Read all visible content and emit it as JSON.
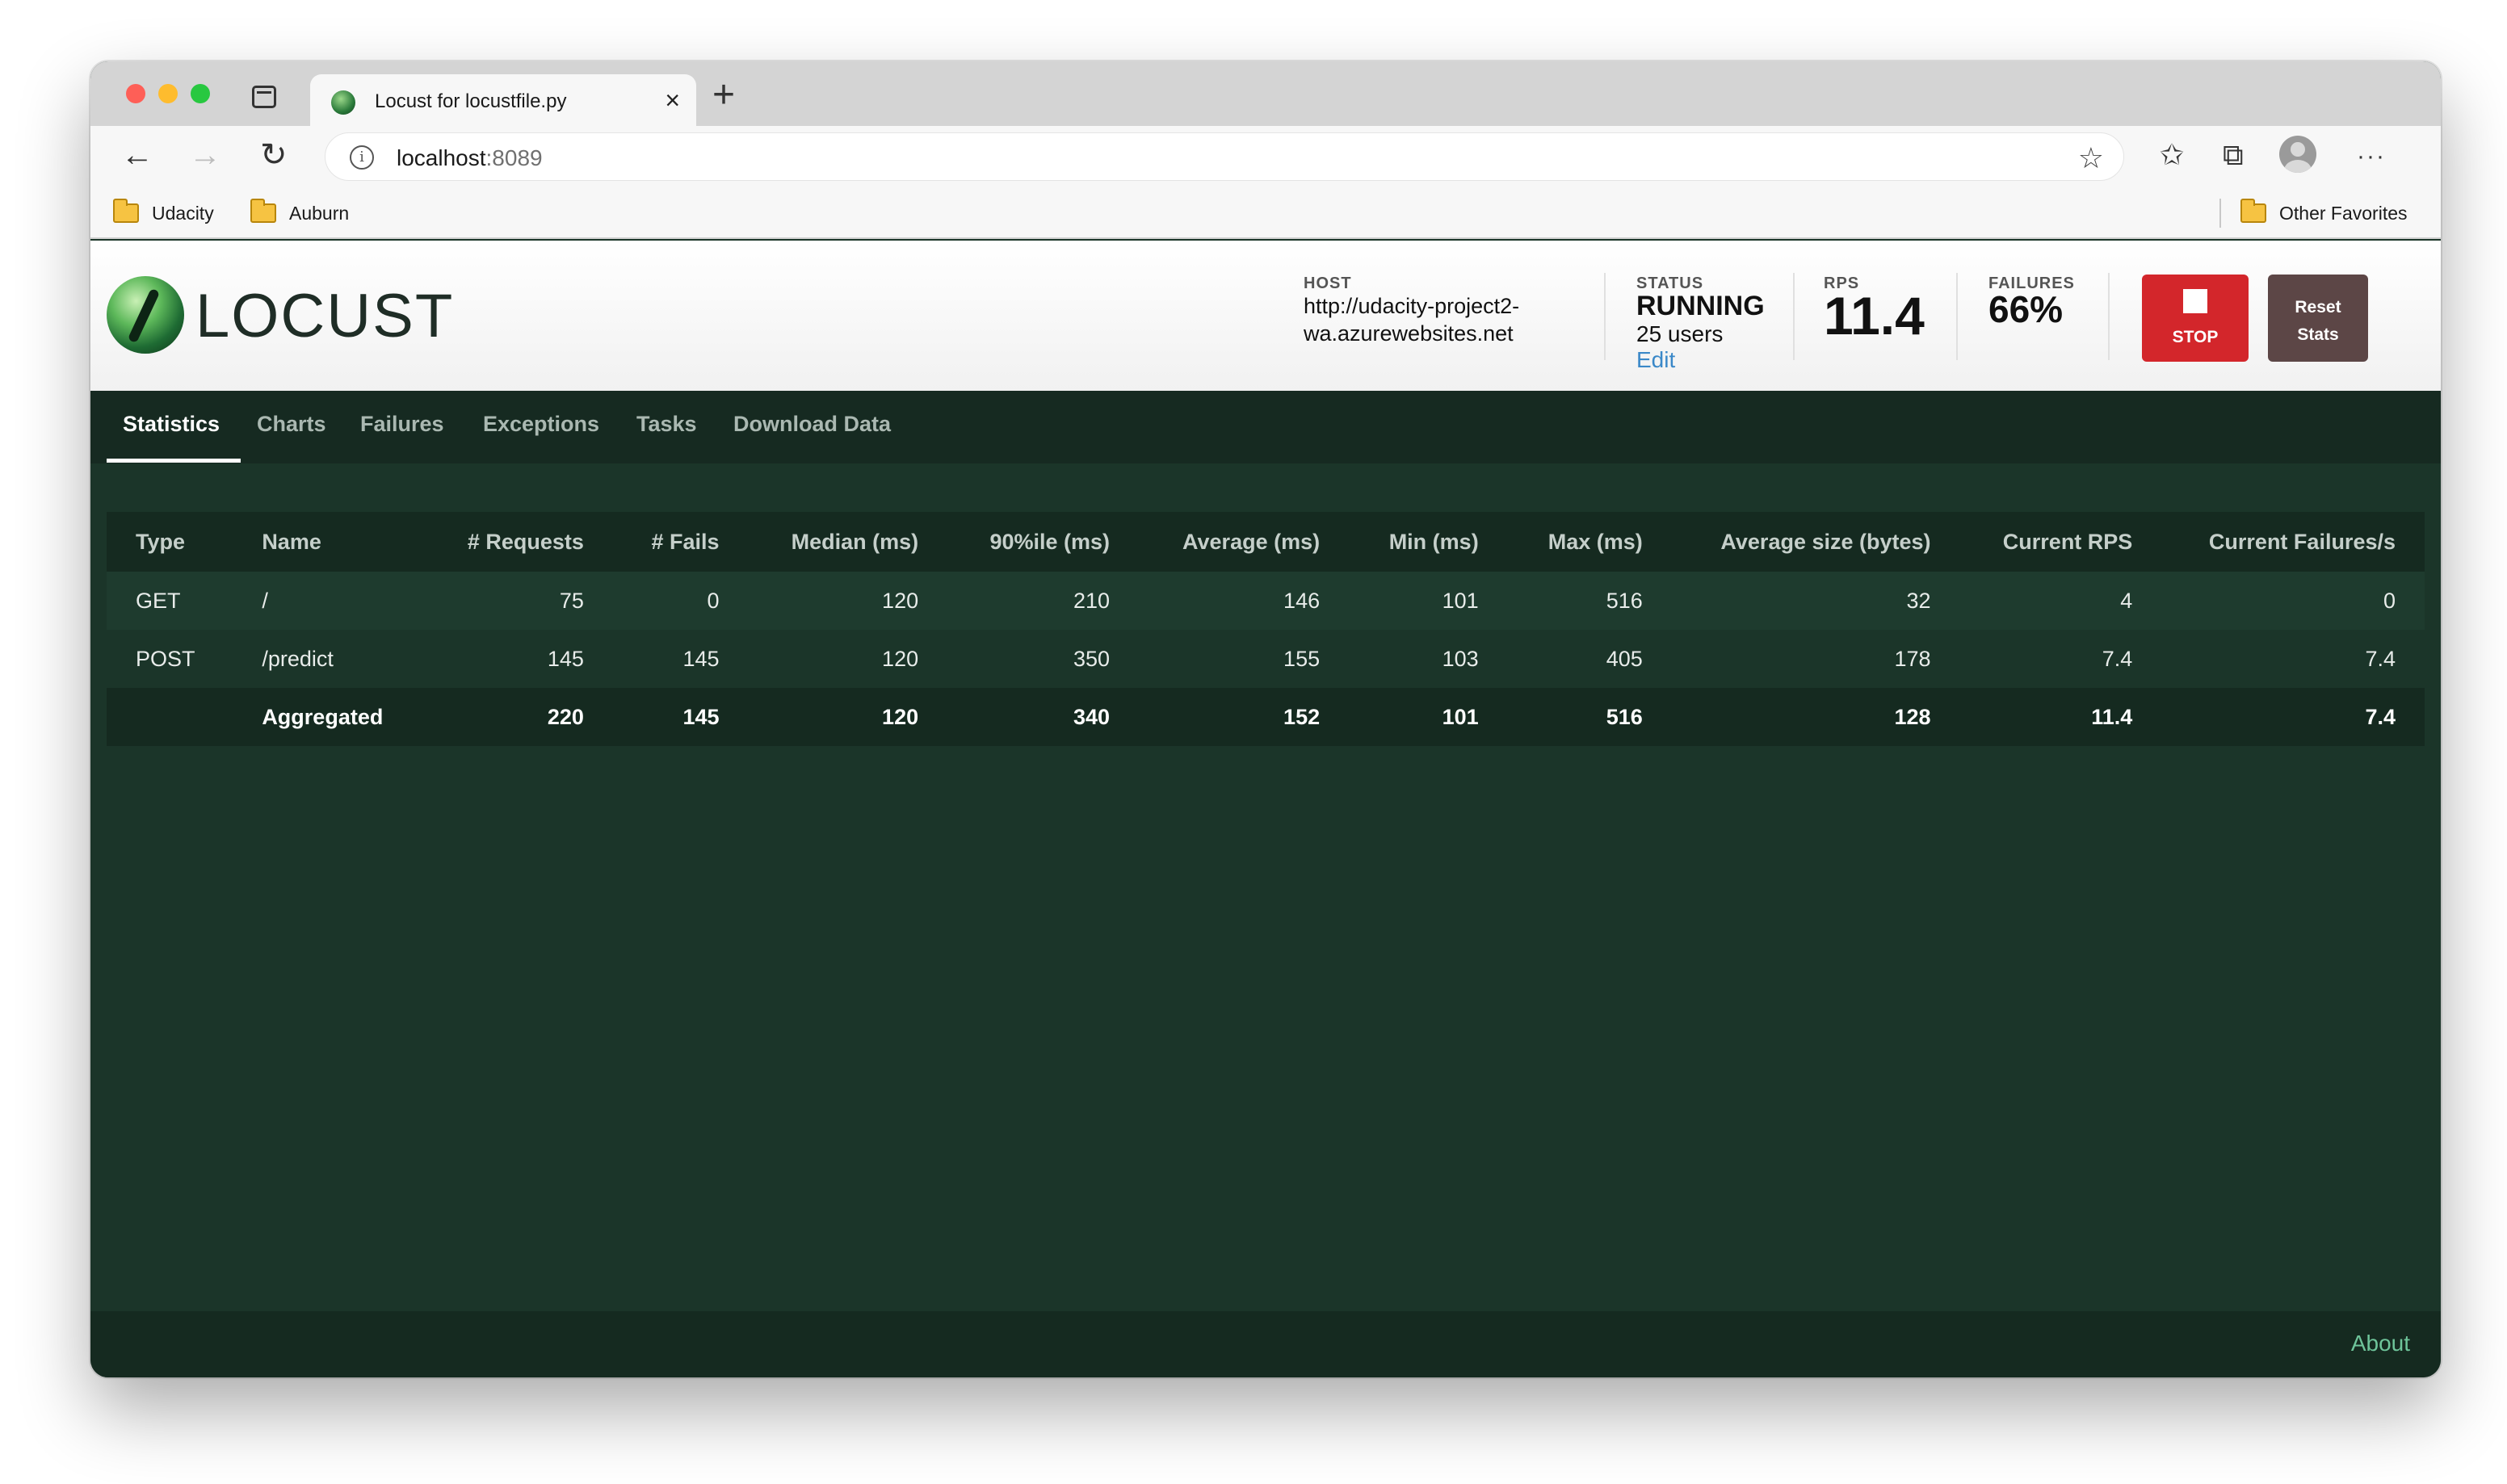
{
  "browser": {
    "tab_title": "Locust for locustfile.py",
    "tab_close": "×",
    "new_tab": "+",
    "url_host": "localhost",
    "url_port": ":8089",
    "bookmarks": [
      "Udacity",
      "Auburn"
    ],
    "other_favorites": "Other Favorites"
  },
  "header": {
    "logo_text": "LOCUST",
    "host_label": "HOST",
    "host_line1": "http://udacity-project2-",
    "host_line2": "wa.azurewebsites.net",
    "status_label": "STATUS",
    "status_value": "RUNNING",
    "users": "25 users",
    "edit": "Edit",
    "rps_label": "RPS",
    "rps_value": "11.4",
    "failures_label": "FAILURES",
    "failures_value": "66%",
    "stop": "STOP",
    "reset_line1": "Reset",
    "reset_line2": "Stats"
  },
  "nav": {
    "tabs": [
      "Statistics",
      "Charts",
      "Failures",
      "Exceptions",
      "Tasks",
      "Download Data"
    ],
    "active": "Statistics"
  },
  "stats": {
    "columns": [
      "Type",
      "Name",
      "# Requests",
      "# Fails",
      "Median (ms)",
      "90%ile (ms)",
      "Average (ms)",
      "Min (ms)",
      "Max (ms)",
      "Average size (bytes)",
      "Current RPS",
      "Current Failures/s"
    ],
    "rows": [
      [
        "GET",
        "/",
        "75",
        "0",
        "120",
        "210",
        "146",
        "101",
        "516",
        "32",
        "4",
        "0"
      ],
      [
        "POST",
        "/predict",
        "145",
        "145",
        "120",
        "350",
        "155",
        "103",
        "405",
        "178",
        "7.4",
        "7.4"
      ]
    ],
    "aggregated": [
      "",
      "Aggregated",
      "220",
      "145",
      "120",
      "340",
      "152",
      "101",
      "516",
      "128",
      "11.4",
      "7.4"
    ]
  },
  "footer": {
    "about": "About"
  },
  "colors": {
    "background": "#1b3529",
    "nav": "#162a21",
    "stop_button": "#d3262b",
    "reset_button": "#5c4646",
    "edit_link": "#3a88c8",
    "about_link": "#6ec49a"
  }
}
